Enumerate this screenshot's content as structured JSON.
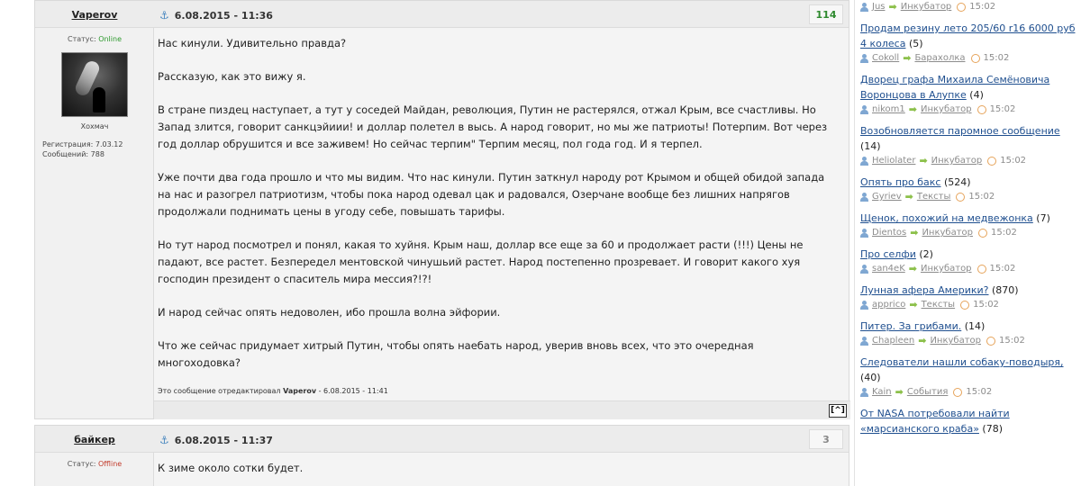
{
  "posts": [
    {
      "author": "Vaperov",
      "status_label": "Статус:",
      "status_value": "Online",
      "avatar_caption": "Хохмач",
      "registration": "Регистрация: 7.03.12",
      "messages": "Сообщений: 788",
      "date": "6.08.2015 - 11:36",
      "number": "114",
      "paragraphs": [
        "Нас кинули. Удивительно правда?",
        "Рассказую, как это вижу я.",
        "В стране пиздец наступает, а тут у соседей Майдан, революция, Путин не растерялся, отжал Крым, все счастливы. Но Запад злится, говорит санкцэйиии! и доллар полетел в высь. А народ говорит, но мы же патриоты! Потерпим. Вот через год доллар обрушится и все заживем! Но сейчас терпим\" Терпим месяц, пол года год. И я терпел.",
        "Уже почти два года прошло и что мы видим. Что нас кинули. Путин заткнул народу рот Крымом и общей обидой запада на нас и разогрел патриотизм, чтобы пока народ одевал цак и радовался, Озерчане вообще без лишних напрягов продолжали поднимать цены в угоду себе, повышать тарифы.",
        "Но тут народ посмотрел и понял, какая то хуйня. Крым наш, доллар все еще за 60 и продолжает расти (!!!) Цены не падают, все растет. Безпередел ментовской чинушьий растет. Народ постепенно прозревает. И говорит какого хуя господин президент о спаситель мира мессия?!?!",
        "И народ сейчас опять недоволен, ибо прошла волна эйфории.",
        "Что же сейчас придумает хитрый Путин, чтобы опять наебать народ, уверив вновь всех, что это очередная многоходовка?"
      ],
      "edit_prefix": "Это сообщение отредактировал",
      "edit_author": "Vaperov",
      "edit_suffix": " - 6.08.2015 - 11:41",
      "up_button": "[^]"
    },
    {
      "author": "байкер",
      "status_label": "Статус:",
      "status_value": "Offline",
      "date": "6.08.2015 - 11:37",
      "number": "3",
      "paragraphs": [
        "К зиме около сотки будет."
      ]
    }
  ],
  "sidebar": {
    "items": [
      {
        "title": "",
        "count": "",
        "user": "Jus",
        "section": "Инкубатор",
        "time": "15:02"
      },
      {
        "title": "Продам резину лето 205/60 r16 6000 руб 4 колеса",
        "count": " (5)",
        "user": "Cokoll",
        "section": "Барахолка",
        "time": "15:02"
      },
      {
        "title": "Дворец графа Михаила Семёновича Воронцова в Алупке",
        "count": " (4)",
        "user": "nikom1",
        "section": "Инкубатор",
        "time": "15:02"
      },
      {
        "title": "Возобновляется паромное сообщение",
        "count": " (14)",
        "user": "Heliolater",
        "section": "Инкубатор",
        "time": "15:02"
      },
      {
        "title": "Опять про бакс",
        "count": " (524)",
        "user": "Gyriev",
        "section": "Тексты",
        "time": "15:02"
      },
      {
        "title": "Щенок, похожий на медвежонка",
        "count": " (7)",
        "user": "Dientos",
        "section": "Инкубатор",
        "time": "15:02"
      },
      {
        "title": "Про селфи",
        "count": " (2)",
        "user": "san4eK",
        "section": "Инкубатор",
        "time": "15:02"
      },
      {
        "title": "Лунная афера Америки?",
        "count": " (870)",
        "user": "apprico",
        "section": "Тексты",
        "time": "15:02"
      },
      {
        "title": "Питер. За грибами.",
        "count": " (14)",
        "user": "Chapleen",
        "section": "Инкубатор",
        "time": "15:02"
      },
      {
        "title": "Следователи нашли собаку-поводыря,",
        "count": " (40)",
        "user": "Kain",
        "section": "События",
        "time": "15:02"
      },
      {
        "title": "От NASA потребовали найти «марсианского краба»",
        "count": " (78)",
        "user": "",
        "section": "",
        "time": ""
      }
    ]
  }
}
